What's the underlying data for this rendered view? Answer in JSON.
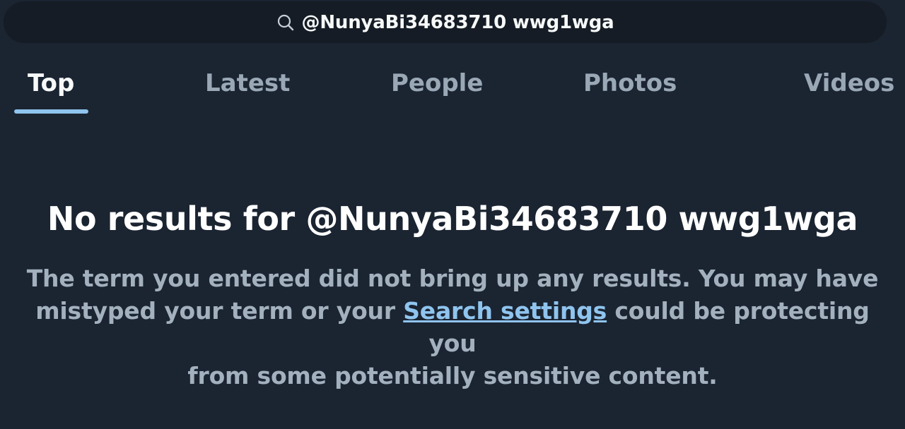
{
  "search": {
    "query": "@NunyaBi34683710 wwg1wga",
    "icon": "search-icon"
  },
  "tabs": [
    {
      "label": "Top",
      "active": true
    },
    {
      "label": "Latest",
      "active": false
    },
    {
      "label": "People",
      "active": false
    },
    {
      "label": "Photos",
      "active": false
    },
    {
      "label": "Videos",
      "active": false
    }
  ],
  "empty_state": {
    "title": "No results for @NunyaBi34683710 wwg1wga",
    "body_line1": "The term you entered did not bring up any results. You may have",
    "body_before_link": "mistyped your term or your ",
    "link_label": "Search settings",
    "body_after_link": " could be protecting you",
    "body_line3": "from some potentially sensitive content."
  },
  "colors": {
    "background": "#1b2431",
    "search_bar": "#151c25",
    "accent": "#8fc4ee",
    "muted_text": "#a3b0bd",
    "inactive_tab": "#9aa8b6"
  }
}
